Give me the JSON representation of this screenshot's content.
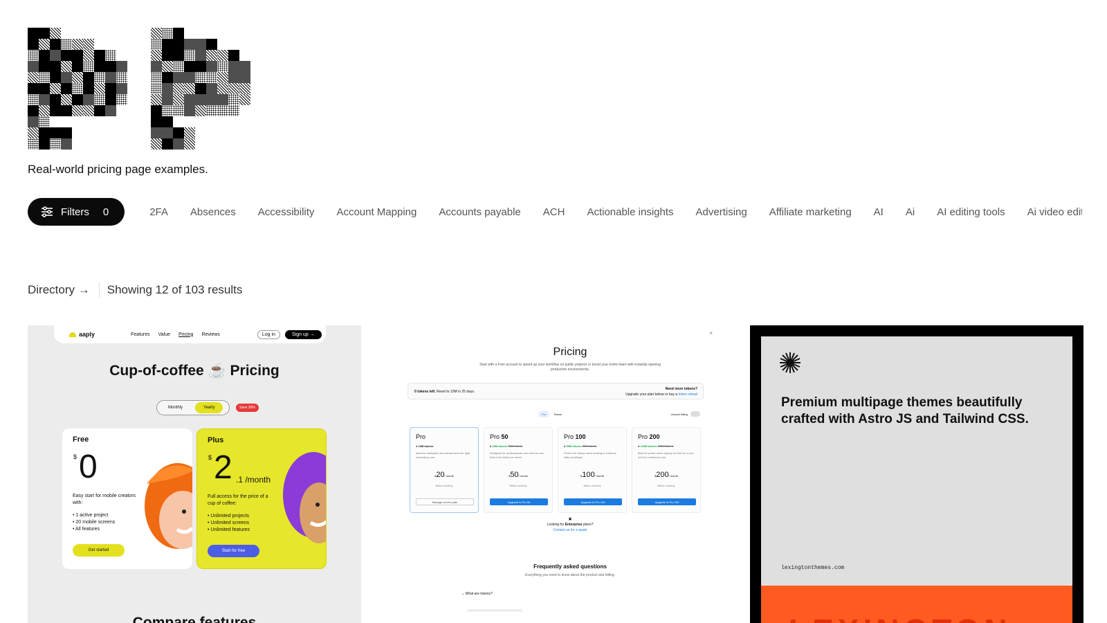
{
  "tagline": "Real-world pricing page examples.",
  "filters": {
    "label": "Filters",
    "count": "0",
    "icon": "sliders-icon"
  },
  "tags": [
    "2FA",
    "Absences",
    "Accessibility",
    "Account Mapping",
    "Accounts payable",
    "ACH",
    "Actionable insights",
    "Advertising",
    "Affiliate marketing",
    "AI",
    "Ai",
    "AI editing tools",
    "Ai video editing"
  ],
  "results": {
    "directory_label": "Directory →",
    "summary": "Showing 12 of 103 results"
  },
  "cards": {
    "aaply": {
      "brand": "aaply",
      "nav": [
        "Features",
        "Value",
        "Pricing",
        "Reviews"
      ],
      "login": "Log in",
      "signup": "Sign up →",
      "title": "Cup-of-coffee ☕ Pricing",
      "toggle_monthly": "Monthly",
      "toggle_yearly": "Yearly",
      "save_badge": "Save 30%",
      "free": {
        "name": "Free",
        "currency": "$",
        "amount": "0",
        "desc": "Easy start for mobile creators with:",
        "features": [
          "1 active project",
          "20 mobile screens",
          "All features"
        ],
        "cta": "Get started"
      },
      "plus": {
        "name": "Plus",
        "currency": "$",
        "amount": "2",
        "per": ".1 /month",
        "desc": "Full access for the price of a cup of coffee:",
        "features": [
          "Unlimited projects",
          "Unlimited screens",
          "Unlimited features"
        ],
        "cta": "Start for free"
      },
      "compare": "Compare features"
    },
    "bolt": {
      "close": "×",
      "title": "Pricing",
      "subtitle": "Start with a Free account to speed up your workflow on public projects or boost your entire team with instantly-opening production environments.",
      "tokens_left_bold": "0 tokens left.",
      "tokens_left_rest": "Reset to 10M in 25 days.",
      "need_more": "Need more tokens?",
      "upgrade_text": "Upgrade your plan below or buy a",
      "token_reload": "token reload",
      "seg_pro": "Pro",
      "seg_teams": "Teams",
      "annual": "Annual billing",
      "plans": [
        {
          "name": "Pro",
          "num": "",
          "tokens": "10M tokens",
          "old": "",
          "desc": "Ideal for hobbyists and casual users for light, exploratory use.",
          "price": "20",
          "billed": "Billed monthly",
          "button": "Manage current plan"
        },
        {
          "name": "Pro",
          "num": "50",
          "tokens": "26M tokens",
          "old": "26M tokens",
          "desc": "Designed for professionals who need to use Bolt a few times per week.",
          "price": "50",
          "billed": "Billed monthly",
          "button": "Upgrade to Pro 50"
        },
        {
          "name": "Pro",
          "num": "100",
          "tokens": "55M tokens",
          "old": "50M tokens",
          "desc": "Perfect for heavy users looking to enhance daily workflows.",
          "price": "100",
          "billed": "Billed monthly",
          "button": "Upgrade to Pro 100"
        },
        {
          "name": "Pro",
          "num": "200",
          "tokens": "120M tokens",
          "old": "100M tokens",
          "desc": "Best for power users relying on Bolt as a core tool for continuous use.",
          "price": "200",
          "billed": "Billed monthly",
          "button": "Upgrade to Pro 200"
        }
      ],
      "per_month": "/ month",
      "enterprise_prefix": "Looking for",
      "enterprise_bold": "Enterprise",
      "enterprise_suffix": "plans?",
      "contact": "Contact us for a quote",
      "faq_title": "Frequently asked questions",
      "faq_sub": "Everything you need to know about the product and billing.",
      "faq_q1": "What are tokens?"
    },
    "lexington": {
      "headline": "Premium multipage themes beautifully crafted with Astro JS and Tailwind CSS.",
      "url": "lexingtonthemes.com",
      "banner": "LEXINGTON"
    }
  },
  "colors": {
    "accent_black": "#0b0b0b",
    "yellow": "#e6e62b",
    "blue": "#1c7be0",
    "orange": "#ff5a1f"
  }
}
